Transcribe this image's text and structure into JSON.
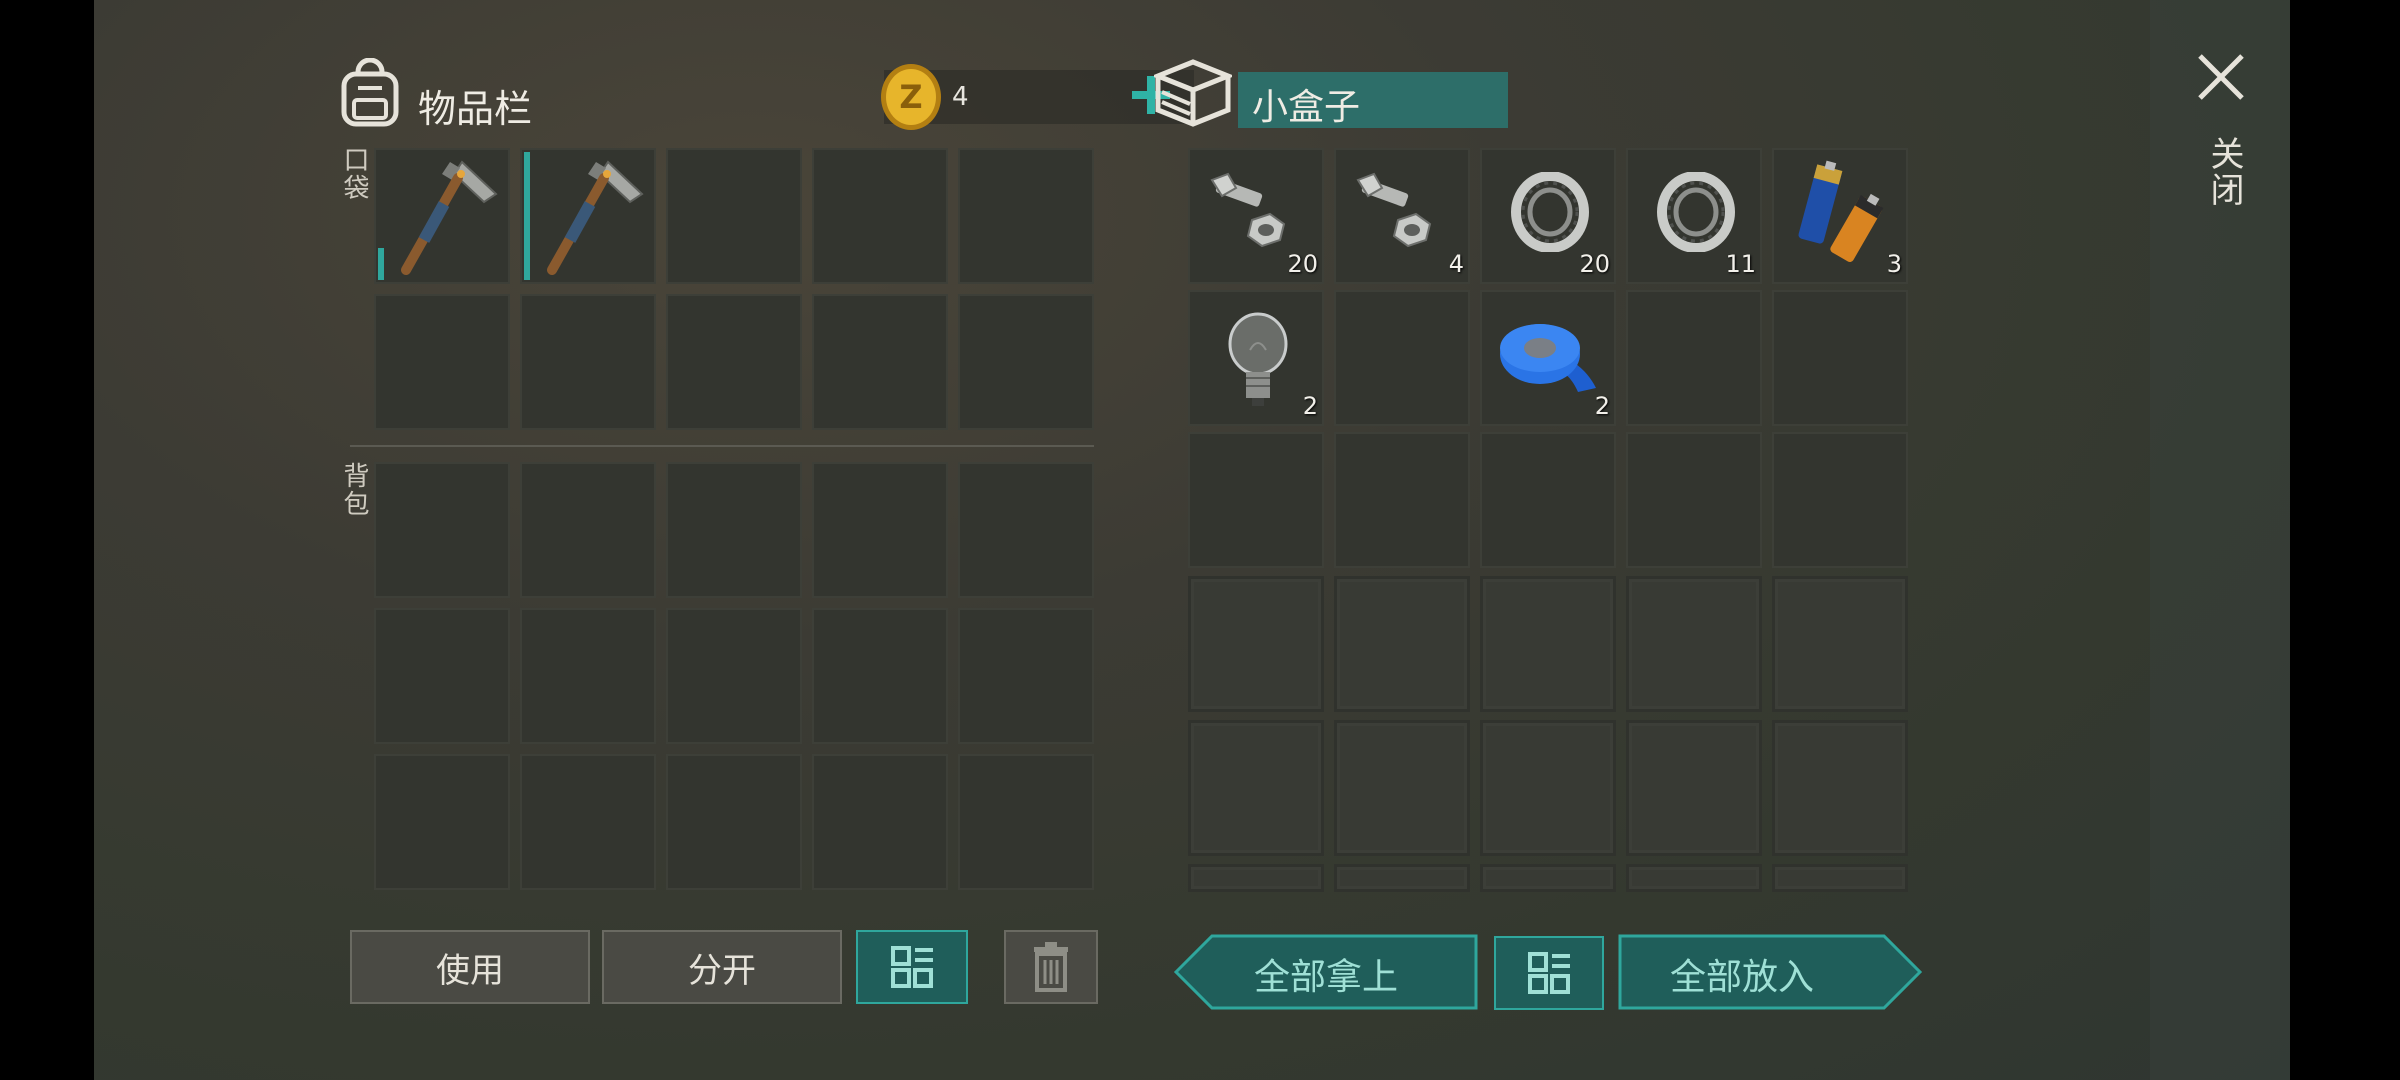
{
  "inventory": {
    "title": "物品栏",
    "coins": "4",
    "pocket_label": "口袋",
    "backpack_label": "背包",
    "pocket_slots": [
      {
        "item": "hammer-icon",
        "qty": ""
      },
      {
        "item": "hammer-icon",
        "qty": ""
      },
      {
        "item": "",
        "qty": ""
      },
      {
        "item": "",
        "qty": ""
      },
      {
        "item": "",
        "qty": ""
      },
      {
        "item": "",
        "qty": ""
      },
      {
        "item": "",
        "qty": ""
      },
      {
        "item": "",
        "qty": ""
      },
      {
        "item": "",
        "qty": ""
      },
      {
        "item": "",
        "qty": ""
      }
    ]
  },
  "container": {
    "title": "小盒子",
    "slots": [
      {
        "item": "bolts-icon",
        "qty": "20"
      },
      {
        "item": "bolts-icon",
        "qty": "4"
      },
      {
        "item": "bearing-icon",
        "qty": "20"
      },
      {
        "item": "bearing-icon",
        "qty": "11"
      },
      {
        "item": "batteries-icon",
        "qty": "3"
      },
      {
        "item": "lightbulb-icon",
        "qty": "2"
      },
      {
        "item": "",
        "qty": ""
      },
      {
        "item": "duct-tape-icon",
        "qty": "2"
      },
      {
        "item": "",
        "qty": ""
      },
      {
        "item": "",
        "qty": ""
      }
    ]
  },
  "buttons": {
    "use": "使用",
    "split": "分开",
    "take_all": "全部拿上",
    "put_all": "全部放入"
  },
  "close_label": "关闭",
  "colors": {
    "accent": "#2fa79d",
    "coin": "#d9a520"
  }
}
